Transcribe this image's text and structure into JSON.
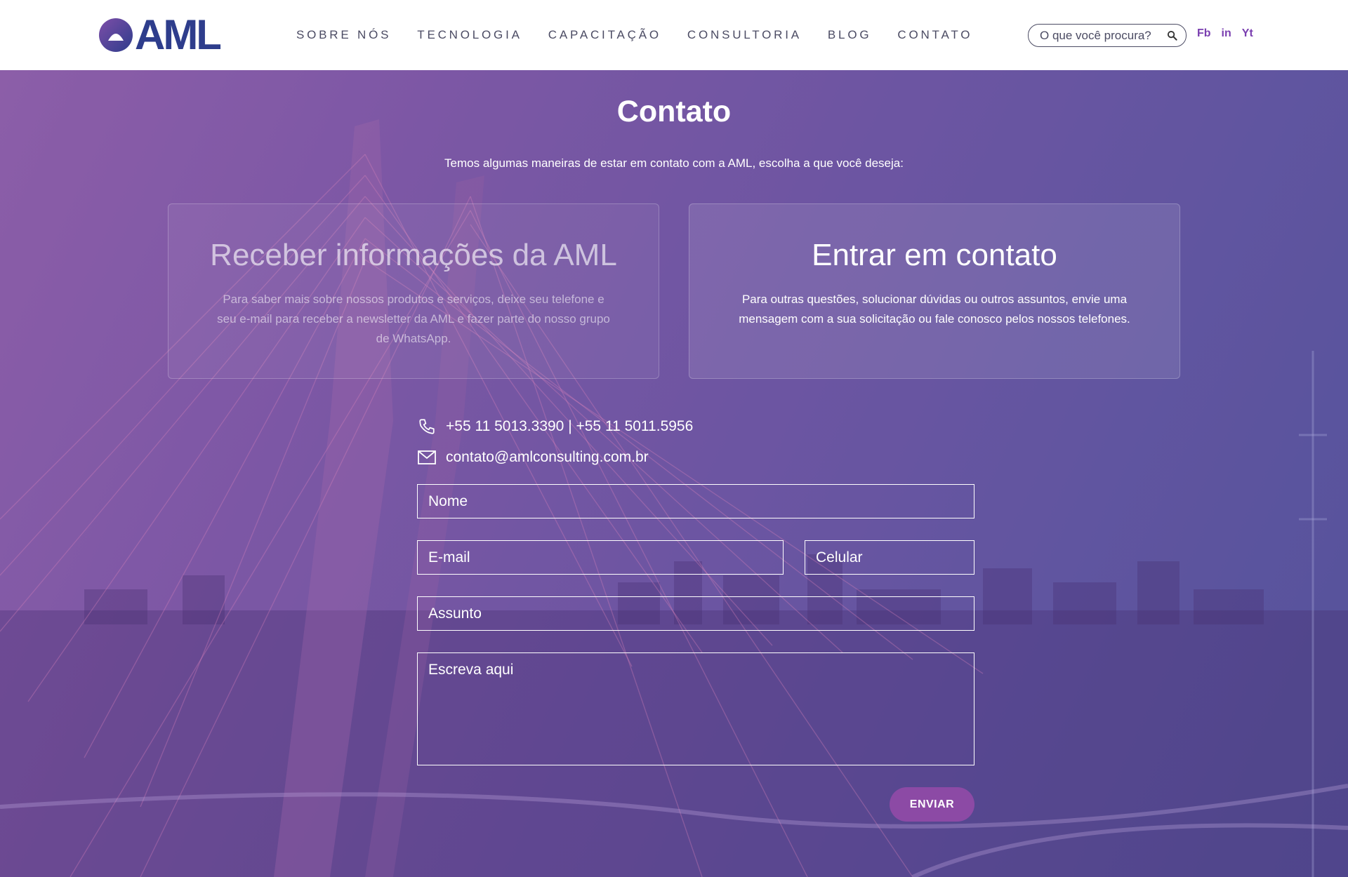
{
  "brand": {
    "logo_text": "AML",
    "primary_color": "#2e3d8c",
    "accent_color": "#8c4aa5"
  },
  "nav": {
    "items": [
      "SOBRE NÓS",
      "TECNOLOGIA",
      "CAPACITAÇÃO",
      "CONSULTORIA",
      "BLOG",
      "CONTATO"
    ]
  },
  "search": {
    "placeholder": "O que você procura?",
    "icon": "search-icon"
  },
  "social": {
    "facebook": "Fb",
    "linkedin": "in",
    "youtube": "Yt"
  },
  "page": {
    "title": "Contato",
    "intro": "Temos algumas maneiras de estar em contato com a AML, escolha a que você deseja:"
  },
  "cards": {
    "newsletter": {
      "title": "Receber informações da AML",
      "text": "Para saber mais sobre nossos produtos e serviços, deixe seu telefone e seu e-mail para receber a newsletter da AML e fazer parte do nosso grupo de WhatsApp."
    },
    "contact": {
      "title": "Entrar em contato",
      "text": "Para outras questões, solucionar dúvidas ou outros assuntos, envie uma mensagem com a sua solicitação ou fale conosco pelos nossos telefones."
    }
  },
  "contact_info": {
    "phone": "+55 11 5013.3390 | +55 11 5011.5956",
    "email": "contato@amlconsulting.com.br"
  },
  "form": {
    "name_placeholder": "Nome",
    "email_placeholder": "E-mail",
    "mobile_placeholder": "Celular",
    "subject_placeholder": "Assunto",
    "message_placeholder": "Escreva aqui",
    "submit_label": "ENVIAR"
  }
}
